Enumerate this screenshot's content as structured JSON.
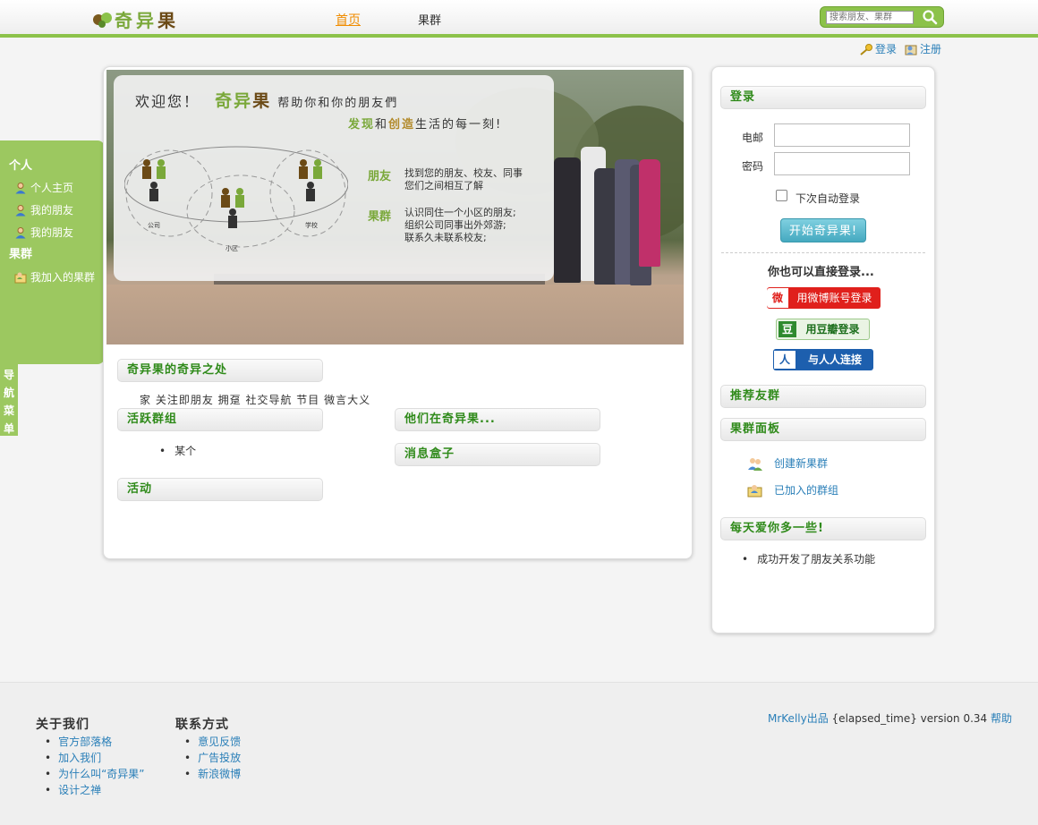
{
  "header": {
    "logo_text_green": "奇异",
    "logo_text_brown": "果",
    "nav_home": "首页",
    "nav_groups": "果群",
    "search_placeholder": "搜索朋友、果群"
  },
  "auth": {
    "login": "登录",
    "register": "注册"
  },
  "sidebar": {
    "personal_heading": "个人",
    "personal_items": [
      "个人主页",
      "我的朋友",
      "我的朋友"
    ],
    "groups_heading": "果群",
    "group_items": [
      "我加入的果群"
    ],
    "tab_label": "导航菜单"
  },
  "banner": {
    "welcome": "欢迎您！",
    "brand_green": "奇异",
    "brand_brown": "果",
    "tagline_1": "帮助你和你的朋友們",
    "tagline_2_a": "发现",
    "tagline_2_b": "和",
    "tagline_2_c": "创造",
    "tagline_2_d": "生活的每一刻!",
    "diagram_labels": [
      "公司",
      "小区",
      "学校"
    ],
    "friends_label": "朋友",
    "friends_text_1": "找到您的朋友、校友、同事",
    "friends_text_2": "您们之间相互了解",
    "groups_label": "果群",
    "groups_text_1": "认识同住一个小区的朋友;",
    "groups_text_2": "组织公司同事出外郊游;",
    "groups_text_3": "联系久未联系校友;"
  },
  "main": {
    "special_title": "奇异果的奇异之处",
    "special_text": "家 关注即朋友 拥趸 社交导航 节目 微言大义",
    "active_groups_title": "活跃群组",
    "active_groups_items": [
      "某个"
    ],
    "they_title": "他们在奇异果...",
    "message_box_title": "消息盒子",
    "activity_title": "活动"
  },
  "login_panel": {
    "title": "登录",
    "email_label": "电邮",
    "password_label": "密码",
    "remember_label": "下次自动登录",
    "submit_label": "开始奇异果!",
    "alt_login_heading": "你也可以直接登录...",
    "weibo_label": "用微博账号登录",
    "douban_label": "用豆瓣登录",
    "renren_label": "与人人连接",
    "recommend_title": "推荐友群",
    "panel_title": "果群面板",
    "create_group": "创建新果群",
    "joined_groups": "已加入的群组",
    "love_title": "每天爱你多一些!",
    "love_items": [
      "成功开发了朋友关系功能"
    ]
  },
  "footer": {
    "about_heading": "关于我们",
    "about_items": [
      "官方部落格",
      "加入我们",
      "为什么叫“奇异果”",
      "设计之禅"
    ],
    "contact_heading": "联系方式",
    "contact_items": [
      "意见反馈",
      "广告投放",
      "新浪微博"
    ],
    "credit_author": "MrKelly出品",
    "credit_text": "{elapsed_time} version 0.34",
    "credit_help": "帮助"
  },
  "colors": {
    "brand_green": "#8cc24a",
    "heading_green": "#2f8a1a",
    "link_blue": "#2a7fb8",
    "nav_active": "#f08c00"
  }
}
